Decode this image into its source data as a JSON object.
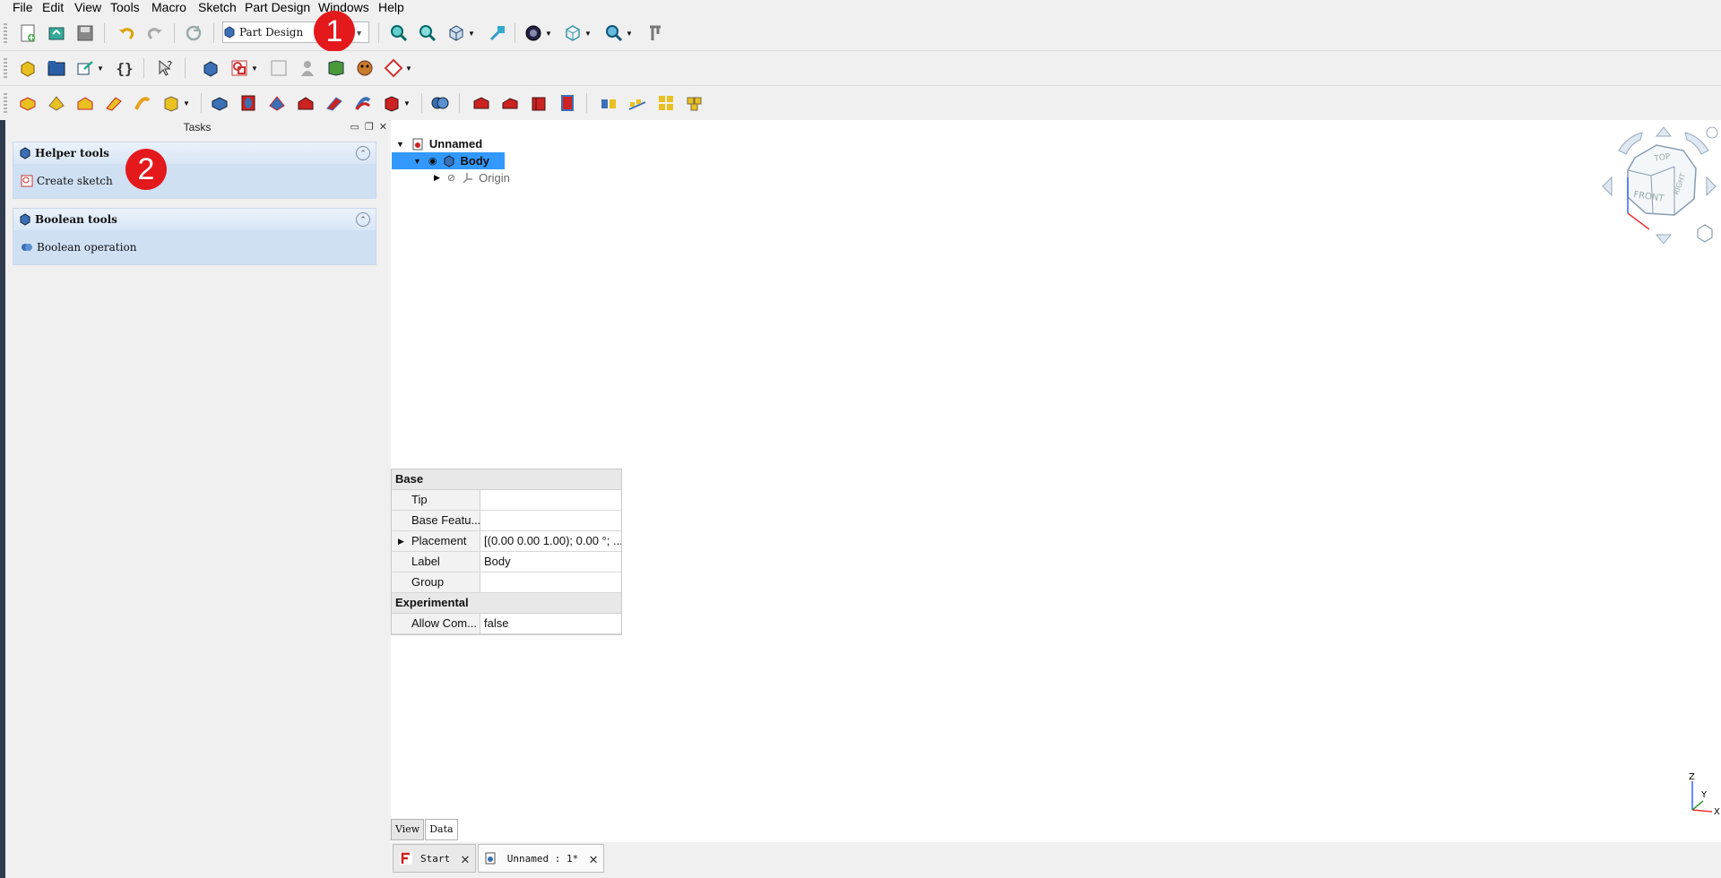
{
  "menu": [
    "File",
    "Edit",
    "View",
    "Tools",
    "Macro",
    "Sketch",
    "Part Design",
    "Windows",
    "Help"
  ],
  "workbench": {
    "selected": "Part Design"
  },
  "badges": [
    "1",
    "2"
  ],
  "tasks": {
    "title": "Tasks",
    "panels": [
      {
        "title": "Helper tools",
        "action": "Create sketch"
      },
      {
        "title": "Boolean tools",
        "action": "Boolean operation"
      }
    ]
  },
  "tree": {
    "root": "Unnamed",
    "body": "Body",
    "origin": "Origin"
  },
  "properties": {
    "groups": [
      {
        "name": "Base",
        "rows": [
          {
            "key": "Tip",
            "value": ""
          },
          {
            "key": "Base Featu...",
            "value": ""
          },
          {
            "key": "Placement",
            "value": "[(0.00 0.00 1.00); 0.00 °; ..."
          },
          {
            "key": "Label",
            "value": "Body"
          },
          {
            "key": "Group",
            "value": ""
          }
        ]
      },
      {
        "name": "Experimental",
        "rows": [
          {
            "key": "Allow Com...",
            "value": "false"
          }
        ]
      }
    ],
    "tabs": [
      "View",
      "Data"
    ]
  },
  "navcube": {
    "top": "TOP",
    "front": "FRONT",
    "right": "RIGHT"
  },
  "axes": {
    "z": "Z",
    "y": "Y",
    "x": "X"
  },
  "doc_tabs": [
    {
      "label": "Start"
    },
    {
      "label": "Unnamed : 1*"
    }
  ],
  "colors": {
    "selection": "#3399ff",
    "badge": "#e4191c",
    "task_panel": "#cfe0f3"
  }
}
